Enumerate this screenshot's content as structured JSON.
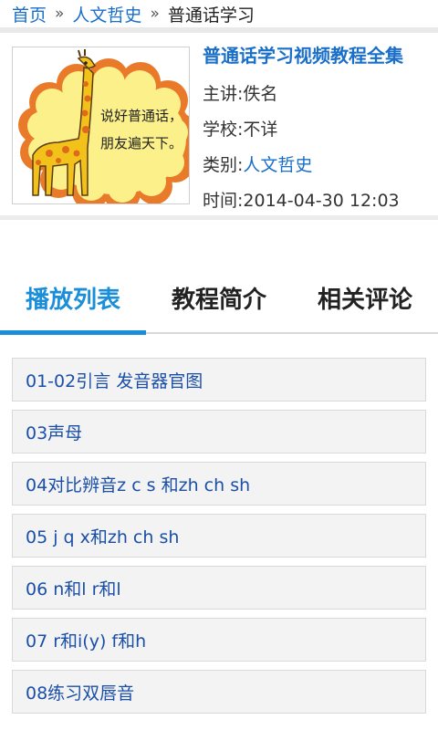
{
  "breadcrumb": {
    "home": "首页",
    "category": "人文哲史",
    "current": "普通话学习",
    "sep": "»"
  },
  "course": {
    "title": "普通话学习视频教程全集",
    "lecturer_label": "主讲:",
    "lecturer": "佚名",
    "school_label": "学校:",
    "school": "不详",
    "category_label": "类别:",
    "category": "人文哲史",
    "time_label": "时间:",
    "time": "2014-04-30 12:03",
    "thumbnail_text_line1": "说好普通话，",
    "thumbnail_text_line2": "朋友遍天下。"
  },
  "tabs": [
    {
      "label": "播放列表",
      "active": true
    },
    {
      "label": "教程简介",
      "active": false
    },
    {
      "label": "相关评论",
      "active": false
    }
  ],
  "playlist": [
    "01-02引言 发音器官图",
    "03声母",
    "04对比辨音z c s 和zh ch sh",
    "05 j q x和zh ch sh",
    "06 n和l r和l",
    "07 r和i(y) f和h",
    "08练习双唇音"
  ],
  "colors": {
    "link": "#1a6fc9",
    "accent": "#1a8ed8",
    "item_text": "#1a4fa8"
  }
}
